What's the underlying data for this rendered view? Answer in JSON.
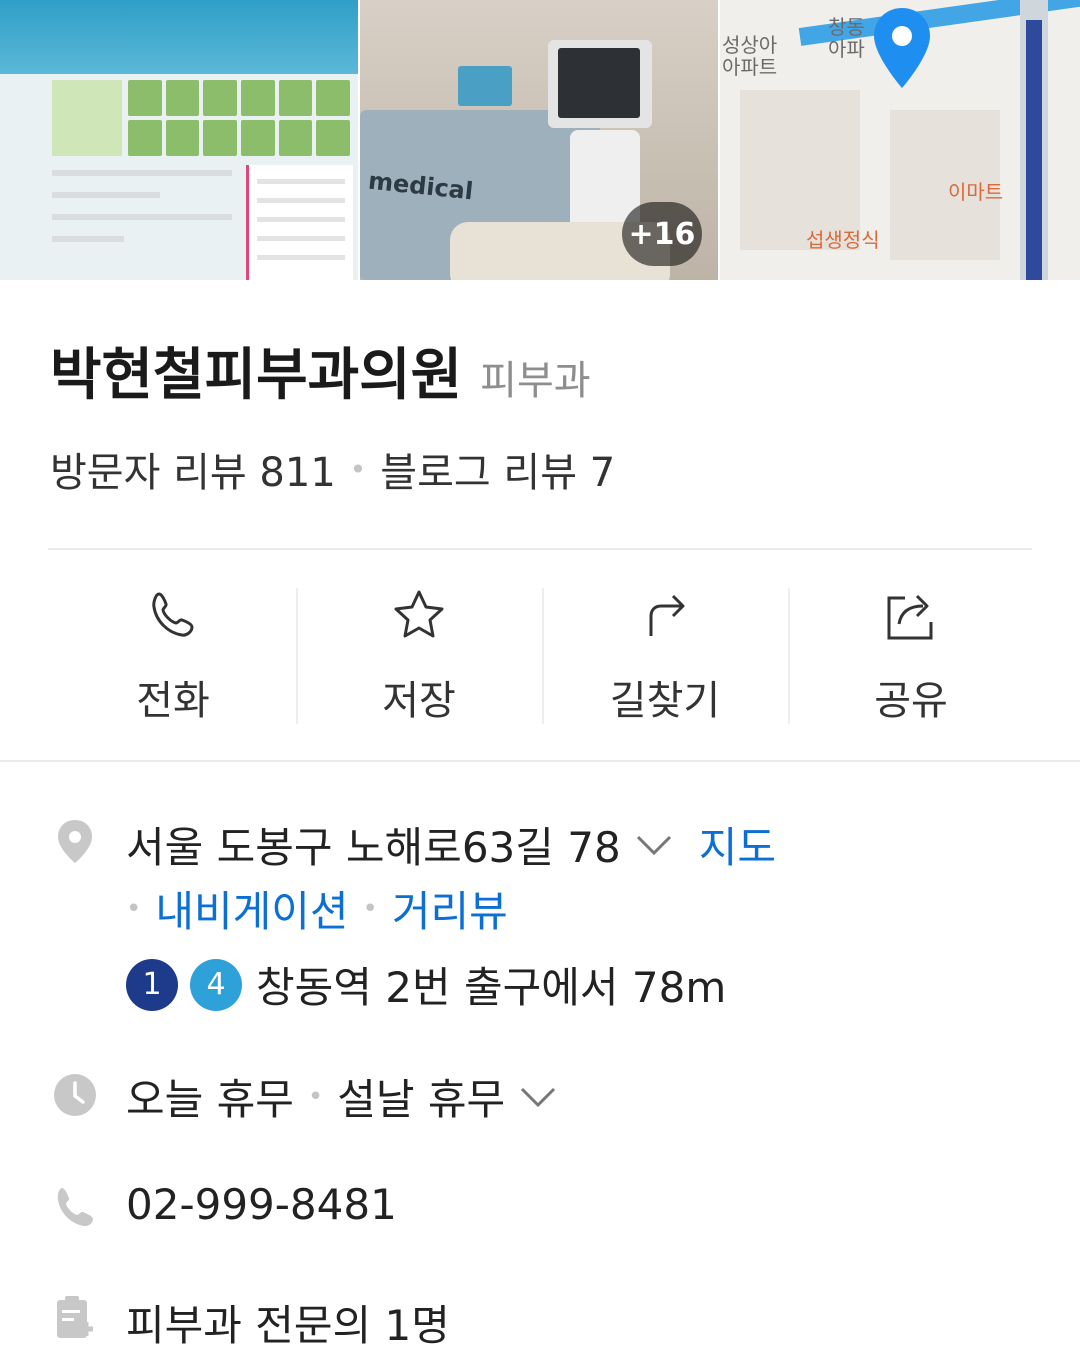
{
  "photos": {
    "more_count": "+16",
    "equipment_label": "medical",
    "map_labels": {
      "apt": "성상아\n아파트",
      "changdong": "창동\n아파",
      "emart": "이마트",
      "restaurant": "섭생정식"
    }
  },
  "place": {
    "name": "박현철피부과의원",
    "category": "피부과",
    "visitor_reviews": "방문자 리뷰 811",
    "blog_reviews": "블로그 리뷰 7"
  },
  "actions": [
    {
      "label": "전화",
      "icon": "phone-icon"
    },
    {
      "label": "저장",
      "icon": "star-icon"
    },
    {
      "label": "길찾기",
      "icon": "directions-icon"
    },
    {
      "label": "공유",
      "icon": "share-icon"
    }
  ],
  "info": {
    "address": "서울 도봉구 노해로63길 78",
    "map_link": "지도",
    "navigation_link": "내비게이션",
    "street_view_link": "거리뷰",
    "subway": {
      "line1": "1",
      "line4": "4",
      "line1_color": "#1e3a8a",
      "line4_color": "#2ea1d9",
      "text": "창동역 2번 출구에서 78m"
    },
    "hours_today": "오늘 휴무",
    "hours_holiday": "설날 휴무",
    "phone": "02-999-8481",
    "specialists": "피부과 전문의 1명"
  },
  "colors": {
    "link": "#0b6fd6",
    "map_pin": "#1e8ff0",
    "icon_gray": "#c8c8c8"
  }
}
